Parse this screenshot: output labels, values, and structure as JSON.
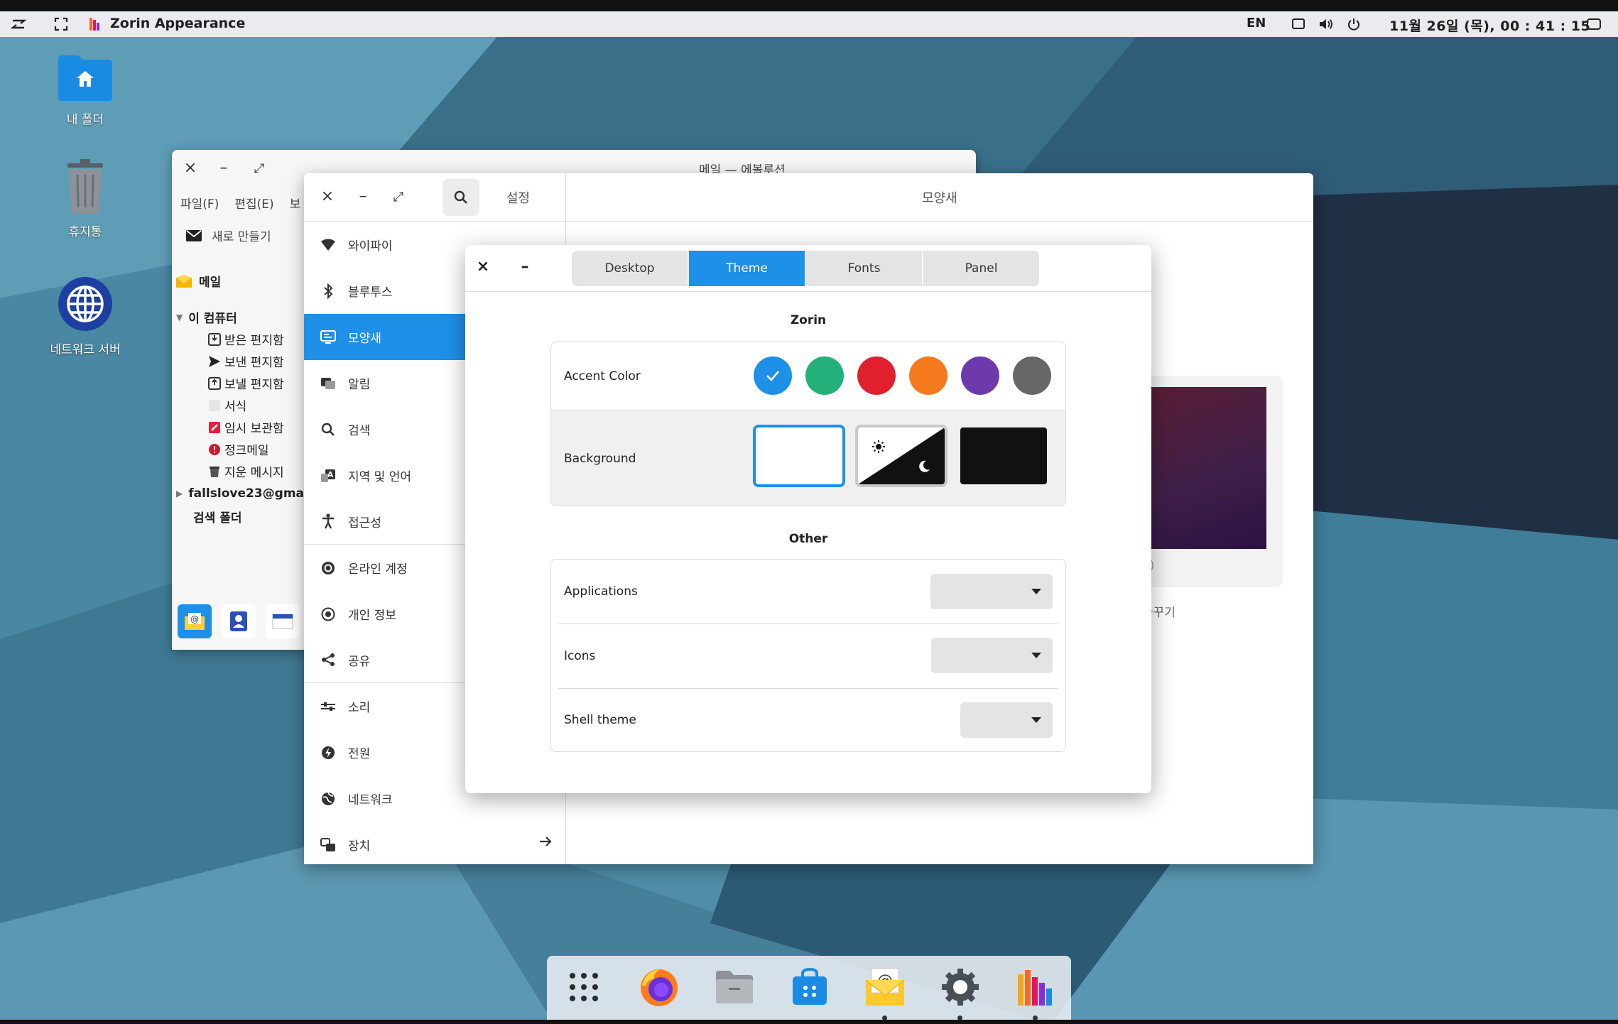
{
  "panel": {
    "app_title": "Zorin Appearance",
    "language": "EN",
    "clock": "11월 26일 (목), 00 : 41 : 15"
  },
  "desktop": {
    "icons": [
      {
        "label": "내 폴더",
        "icon": "home-folder-icon"
      },
      {
        "label": "휴지통",
        "icon": "trash-icon"
      },
      {
        "label": "네트워크 서버",
        "icon": "globe-icon"
      }
    ]
  },
  "mail": {
    "title": "메일 — 에볼루션",
    "menu": [
      "파일(F)",
      "편집(E)",
      "보"
    ],
    "new_label": "새로 만들기",
    "mail_header": "메일",
    "computer": "이 컴퓨터",
    "folders": [
      "받은 편지함",
      "보낸 편지함",
      "보낼 편지함",
      "서식",
      "임시 보관함",
      "정크메일",
      "지운 메시지"
    ],
    "account": "fallslove23@gma",
    "search_folder": "검색 폴더"
  },
  "settings": {
    "sidebar_title": "설정",
    "page_title": "모양새",
    "items": [
      {
        "label": "와이파이",
        "icon": "wifi-icon"
      },
      {
        "label": "블루투스",
        "icon": "bluetooth-icon"
      },
      {
        "label": "모양새",
        "icon": "display-icon"
      },
      {
        "label": "알림",
        "icon": "notification-icon"
      },
      {
        "label": "검색",
        "icon": "search-icon"
      },
      {
        "label": "지역 및 언어",
        "icon": "language-icon"
      },
      {
        "label": "접근성",
        "icon": "accessibility-icon"
      },
      {
        "label": "온라인 계정",
        "icon": "online-accounts-icon"
      },
      {
        "label": "개인 정보",
        "icon": "privacy-icon"
      },
      {
        "label": "공유",
        "icon": "share-icon"
      },
      {
        "label": "소리",
        "icon": "sound-icon"
      },
      {
        "label": "전원",
        "icon": "power-icon"
      },
      {
        "label": "네트워크",
        "icon": "network-icon"
      },
      {
        "label": "장치",
        "icon": "devices-icon"
      }
    ],
    "preview_paren": ")",
    "preview_label": "바꾸기"
  },
  "appearance": {
    "tabs": [
      "Desktop",
      "Theme",
      "Fonts",
      "Panel"
    ],
    "active_tab": "Theme",
    "zorin_title": "Zorin",
    "accent_label": "Accent Color",
    "accent_colors": [
      "#1e90e8",
      "#24b07a",
      "#e0202c",
      "#f57a1e",
      "#6c3aab",
      "#676767"
    ],
    "selected_accent": "#1e90e8",
    "background_label": "Background",
    "background_options": [
      "light",
      "auto",
      "dark"
    ],
    "selected_background": "light",
    "other_title": "Other",
    "applications_label": "Applications",
    "icons_label": "Icons",
    "shell_label": "Shell theme"
  },
  "dock": {
    "apps": [
      "app-grid-icon",
      "firefox-icon",
      "files-icon",
      "software-store-icon",
      "mail-icon",
      "settings-icon",
      "appearance-icon"
    ]
  }
}
